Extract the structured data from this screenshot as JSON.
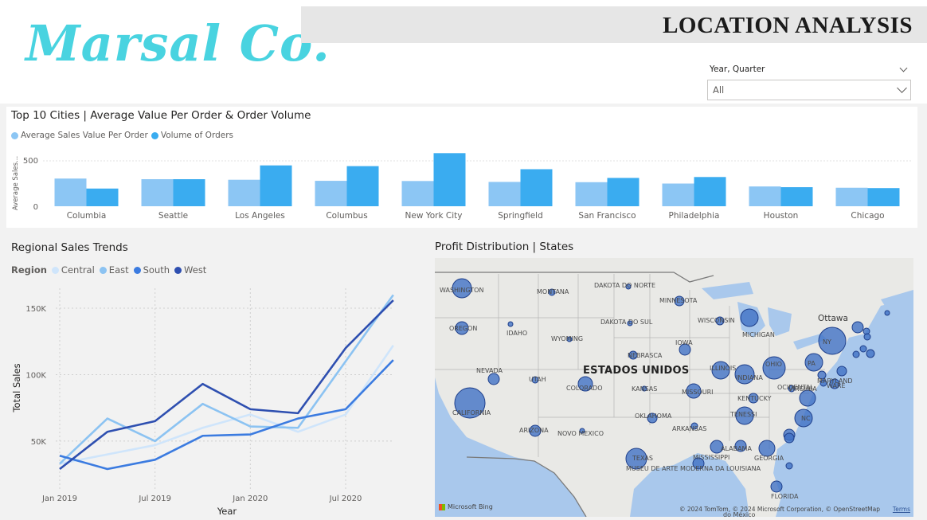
{
  "header": {
    "logo_text": "Marsal Co.",
    "title": "LOCATION ANALYSIS"
  },
  "slicer": {
    "label": "Year, Quarter",
    "value": "All"
  },
  "colors": {
    "logo": "#49d3e0",
    "avg_sales": "#8cc6f4",
    "volume": "#3aacf0",
    "central": "#cfe5fb",
    "east": "#8cc3f2",
    "south": "#3b7be0",
    "west": "#2e4fb0",
    "bubble": "#3d6fc4"
  },
  "bar_chart": {
    "title": "Top 10 Cities | Average Value Per Order & Order Volume",
    "legend": [
      "Average Sales Value Per Order",
      "Volume of Orders"
    ],
    "y_axis_label": "Average Sales...",
    "y_ticks": [
      "500",
      "0"
    ]
  },
  "line_chart": {
    "title": "Regional Sales Trends",
    "legend_title": "Region",
    "x_label": "Year",
    "y_label": "Total Sales",
    "x_ticks": [
      "Jan 2019",
      "Jul 2019",
      "Jan 2020",
      "Jul 2020"
    ],
    "y_ticks": [
      "150K",
      "100K",
      "50K"
    ]
  },
  "map": {
    "title": "Profit Distribution | States",
    "country_label": "ESTADOS UNIDOS",
    "city_label": "Ottawa",
    "state_labels": [
      "WASHINGTON",
      "MONTANA",
      "DAKOTA DO NORTE",
      "MINNESOTA",
      "OREGON",
      "IDAHO",
      "DAKOTA DO SUL",
      "WISCONSIN",
      "WYOMING",
      "MICHIGAN",
      "NEBRASCA",
      "IOWA",
      "NEVADA",
      "UTAH",
      "COLORADO",
      "KANSAS",
      "ILLINOIS",
      "INDIANA",
      "OHIO",
      "PA",
      "NY",
      "MISSOURI",
      "KENTUCKY",
      "VIRGINIA",
      "OCIDENTAL",
      "MARYLAND",
      "WARE",
      "CALIFORNIA",
      "OKLAHOMA",
      "TENESSI",
      "NC",
      "ARIZONA",
      "NOVO MEXICO",
      "ARKANSAS",
      "TEXAS",
      "ALABAMA",
      "GEORGIA",
      "MISSISSIPPI",
      "MUSEU DE ARTE MODERNA DA LOUISIANA",
      "FLORIDA",
      "do México"
    ],
    "attribution": "Microsoft Bing",
    "copyright": "© 2024 TomTom, © 2024 Microsoft Corporation, © OpenStreetMap",
    "terms": "Terms"
  },
  "chart_data": [
    {
      "type": "bar",
      "title": "Top 10 Cities | Average Value Per Order & Order Volume",
      "categories": [
        "Columbia",
        "Seattle",
        "Los Angeles",
        "Columbus",
        "New York City",
        "Springfield",
        "San Francisco",
        "Philadelphia",
        "Houston",
        "Chicago"
      ],
      "series": [
        {
          "name": "Average Sales Value Per Order",
          "values": [
            305,
            298,
            292,
            280,
            278,
            268,
            265,
            250,
            218,
            204
          ]
        },
        {
          "name": "Volume of Orders",
          "values": [
            195,
            298,
            450,
            442,
            585,
            408,
            312,
            322,
            210,
            200
          ]
        }
      ],
      "ylabel": "Average Sales...",
      "ylim": [
        0,
        620
      ]
    },
    {
      "type": "line",
      "title": "Regional Sales Trends",
      "xlabel": "Year",
      "ylabel": "Total Sales",
      "x": [
        "2019-01",
        "2019-04",
        "2019-07",
        "2019-10",
        "2020-01",
        "2020-04",
        "2020-07",
        "2020-10"
      ],
      "x_ticks": [
        "Jan 2019",
        "Jul 2019",
        "Jan 2020",
        "Jul 2020"
      ],
      "ylim": [
        20000,
        165000
      ],
      "series": [
        {
          "name": "Central",
          "values": [
            33000,
            40000,
            47000,
            60000,
            70000,
            57000,
            70000,
            122000
          ]
        },
        {
          "name": "East",
          "values": [
            33000,
            67000,
            50000,
            78000,
            61000,
            60000,
            110000,
            160000
          ]
        },
        {
          "name": "South",
          "values": [
            39000,
            29000,
            36000,
            54000,
            55000,
            67000,
            74000,
            111000
          ]
        },
        {
          "name": "West",
          "values": [
            29000,
            57000,
            65000,
            93000,
            74000,
            71000,
            120000,
            156000
          ]
        }
      ]
    }
  ]
}
